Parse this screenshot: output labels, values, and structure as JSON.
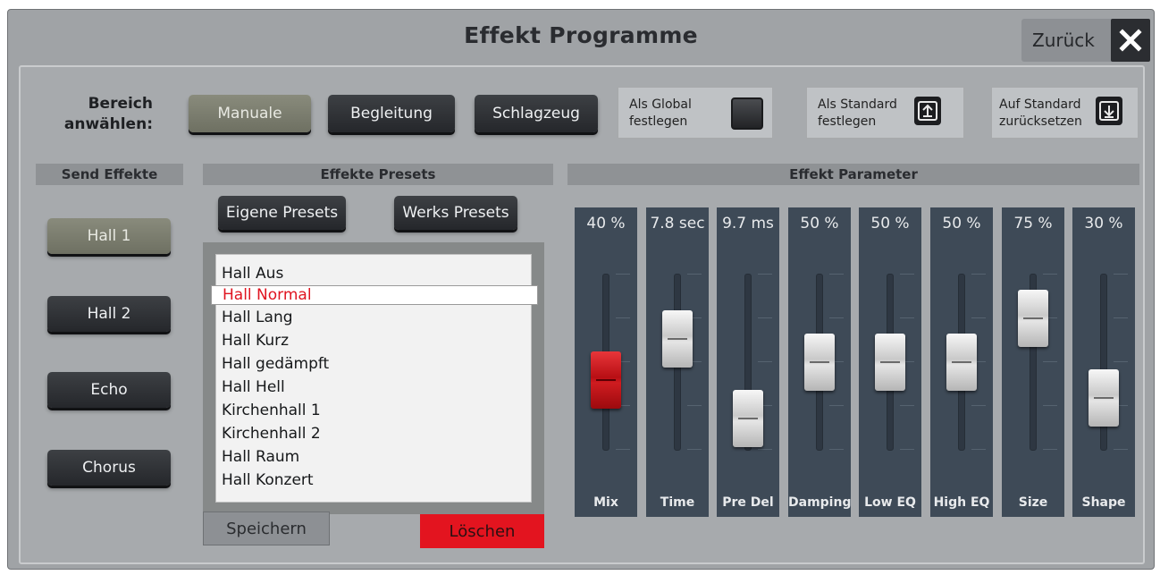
{
  "window": {
    "title": "Effekt Programme",
    "back_label": "Zurück"
  },
  "bereich": {
    "label_line1": "Bereich",
    "label_line2": "anwählen:",
    "buttons": [
      "Manuale",
      "Begleitung",
      "Schlagzeug"
    ],
    "active": "Manuale"
  },
  "options": {
    "global_line1": "Als Global",
    "global_line2": "festlegen",
    "standard_line1": "Als Standard",
    "standard_line2": "festlegen",
    "reset_line1": "Auf Standard",
    "reset_line2": "zurücksetzen"
  },
  "send_effects": {
    "header": "Send Effekte",
    "items": [
      "Hall 1",
      "Hall 2",
      "Echo",
      "Chorus"
    ],
    "active": "Hall 1"
  },
  "presets": {
    "header": "Effekte Presets",
    "own_label": "Eigene Presets",
    "factory_label": "Werks Presets",
    "items": [
      "Hall Aus",
      "Hall Normal",
      "Hall Lang",
      "Hall Kurz",
      "Hall gedämpft",
      "Hall Hell",
      "Kirchenhall 1",
      "Kirchenhall 2",
      "Hall Raum",
      "Hall Konzert"
    ],
    "selected": "Hall Normal",
    "save_label": "Speichern",
    "delete_label": "Löschen"
  },
  "parameters": {
    "header": "Effekt Parameter",
    "faders": [
      {
        "name": "Mix",
        "value": "40 %",
        "level": 0.4,
        "active": true
      },
      {
        "name": "Time",
        "value": "7.8 sec",
        "level": 0.63,
        "active": false
      },
      {
        "name": "Pre Del",
        "value": "9.7 ms",
        "level": 0.18,
        "active": false
      },
      {
        "name": "Damping",
        "value": "50 %",
        "level": 0.5,
        "active": false
      },
      {
        "name": "Low EQ",
        "value": "50 %",
        "level": 0.5,
        "active": false
      },
      {
        "name": "High EQ",
        "value": "50 %",
        "level": 0.5,
        "active": false
      },
      {
        "name": "Size",
        "value": "75 %",
        "level": 0.75,
        "active": false
      },
      {
        "name": "Shape",
        "value": "30 %",
        "level": 0.3,
        "active": false
      }
    ]
  },
  "colors": {
    "panel": "#a7aaad",
    "fader_bg": "#3e4a57",
    "selected_text": "#e01420",
    "delete_bg": "#e3141f",
    "active_button": "#7d7f70"
  }
}
